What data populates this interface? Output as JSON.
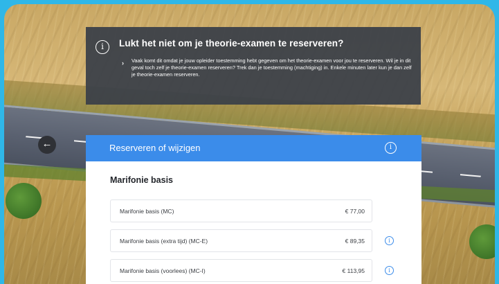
{
  "info_banner": {
    "icon": "info-icon",
    "title": "Lukt het niet om je theorie-examen te reserveren?",
    "body": "Vaak komt dit omdat je jouw opleider toestemming hebt gegeven om het theorie-examen voor jou te reserveren. Wil je in dit geval toch zelf je theorie-examen reserveren? Trek dan je toestemming (machtiging) in. Enkele minuten later kun je dan zelf je theorie-examen reserveren.",
    "chevron": "›"
  },
  "back_button": {
    "icon": "arrow-left-icon",
    "glyph": "←"
  },
  "panel": {
    "title": "Reserveren of wijzigen",
    "header_icon": "info-icon",
    "section_title": "Marifonie basis",
    "options": [
      {
        "name": "Marifonie basis (MC)",
        "price": "€ 77,00",
        "has_info": false
      },
      {
        "name": "Marifonie basis (extra tijd) (MC-E)",
        "price": "€ 89,35",
        "has_info": true
      },
      {
        "name": "Marifonie basis (voorlees) (MC-I)",
        "price": "€ 113,95",
        "has_info": true
      }
    ]
  },
  "colors": {
    "frame": "#2fb7e8",
    "header_blue": "#3b8cea",
    "banner_bg": "#3a4048"
  },
  "glyphs": {
    "info": "i"
  }
}
